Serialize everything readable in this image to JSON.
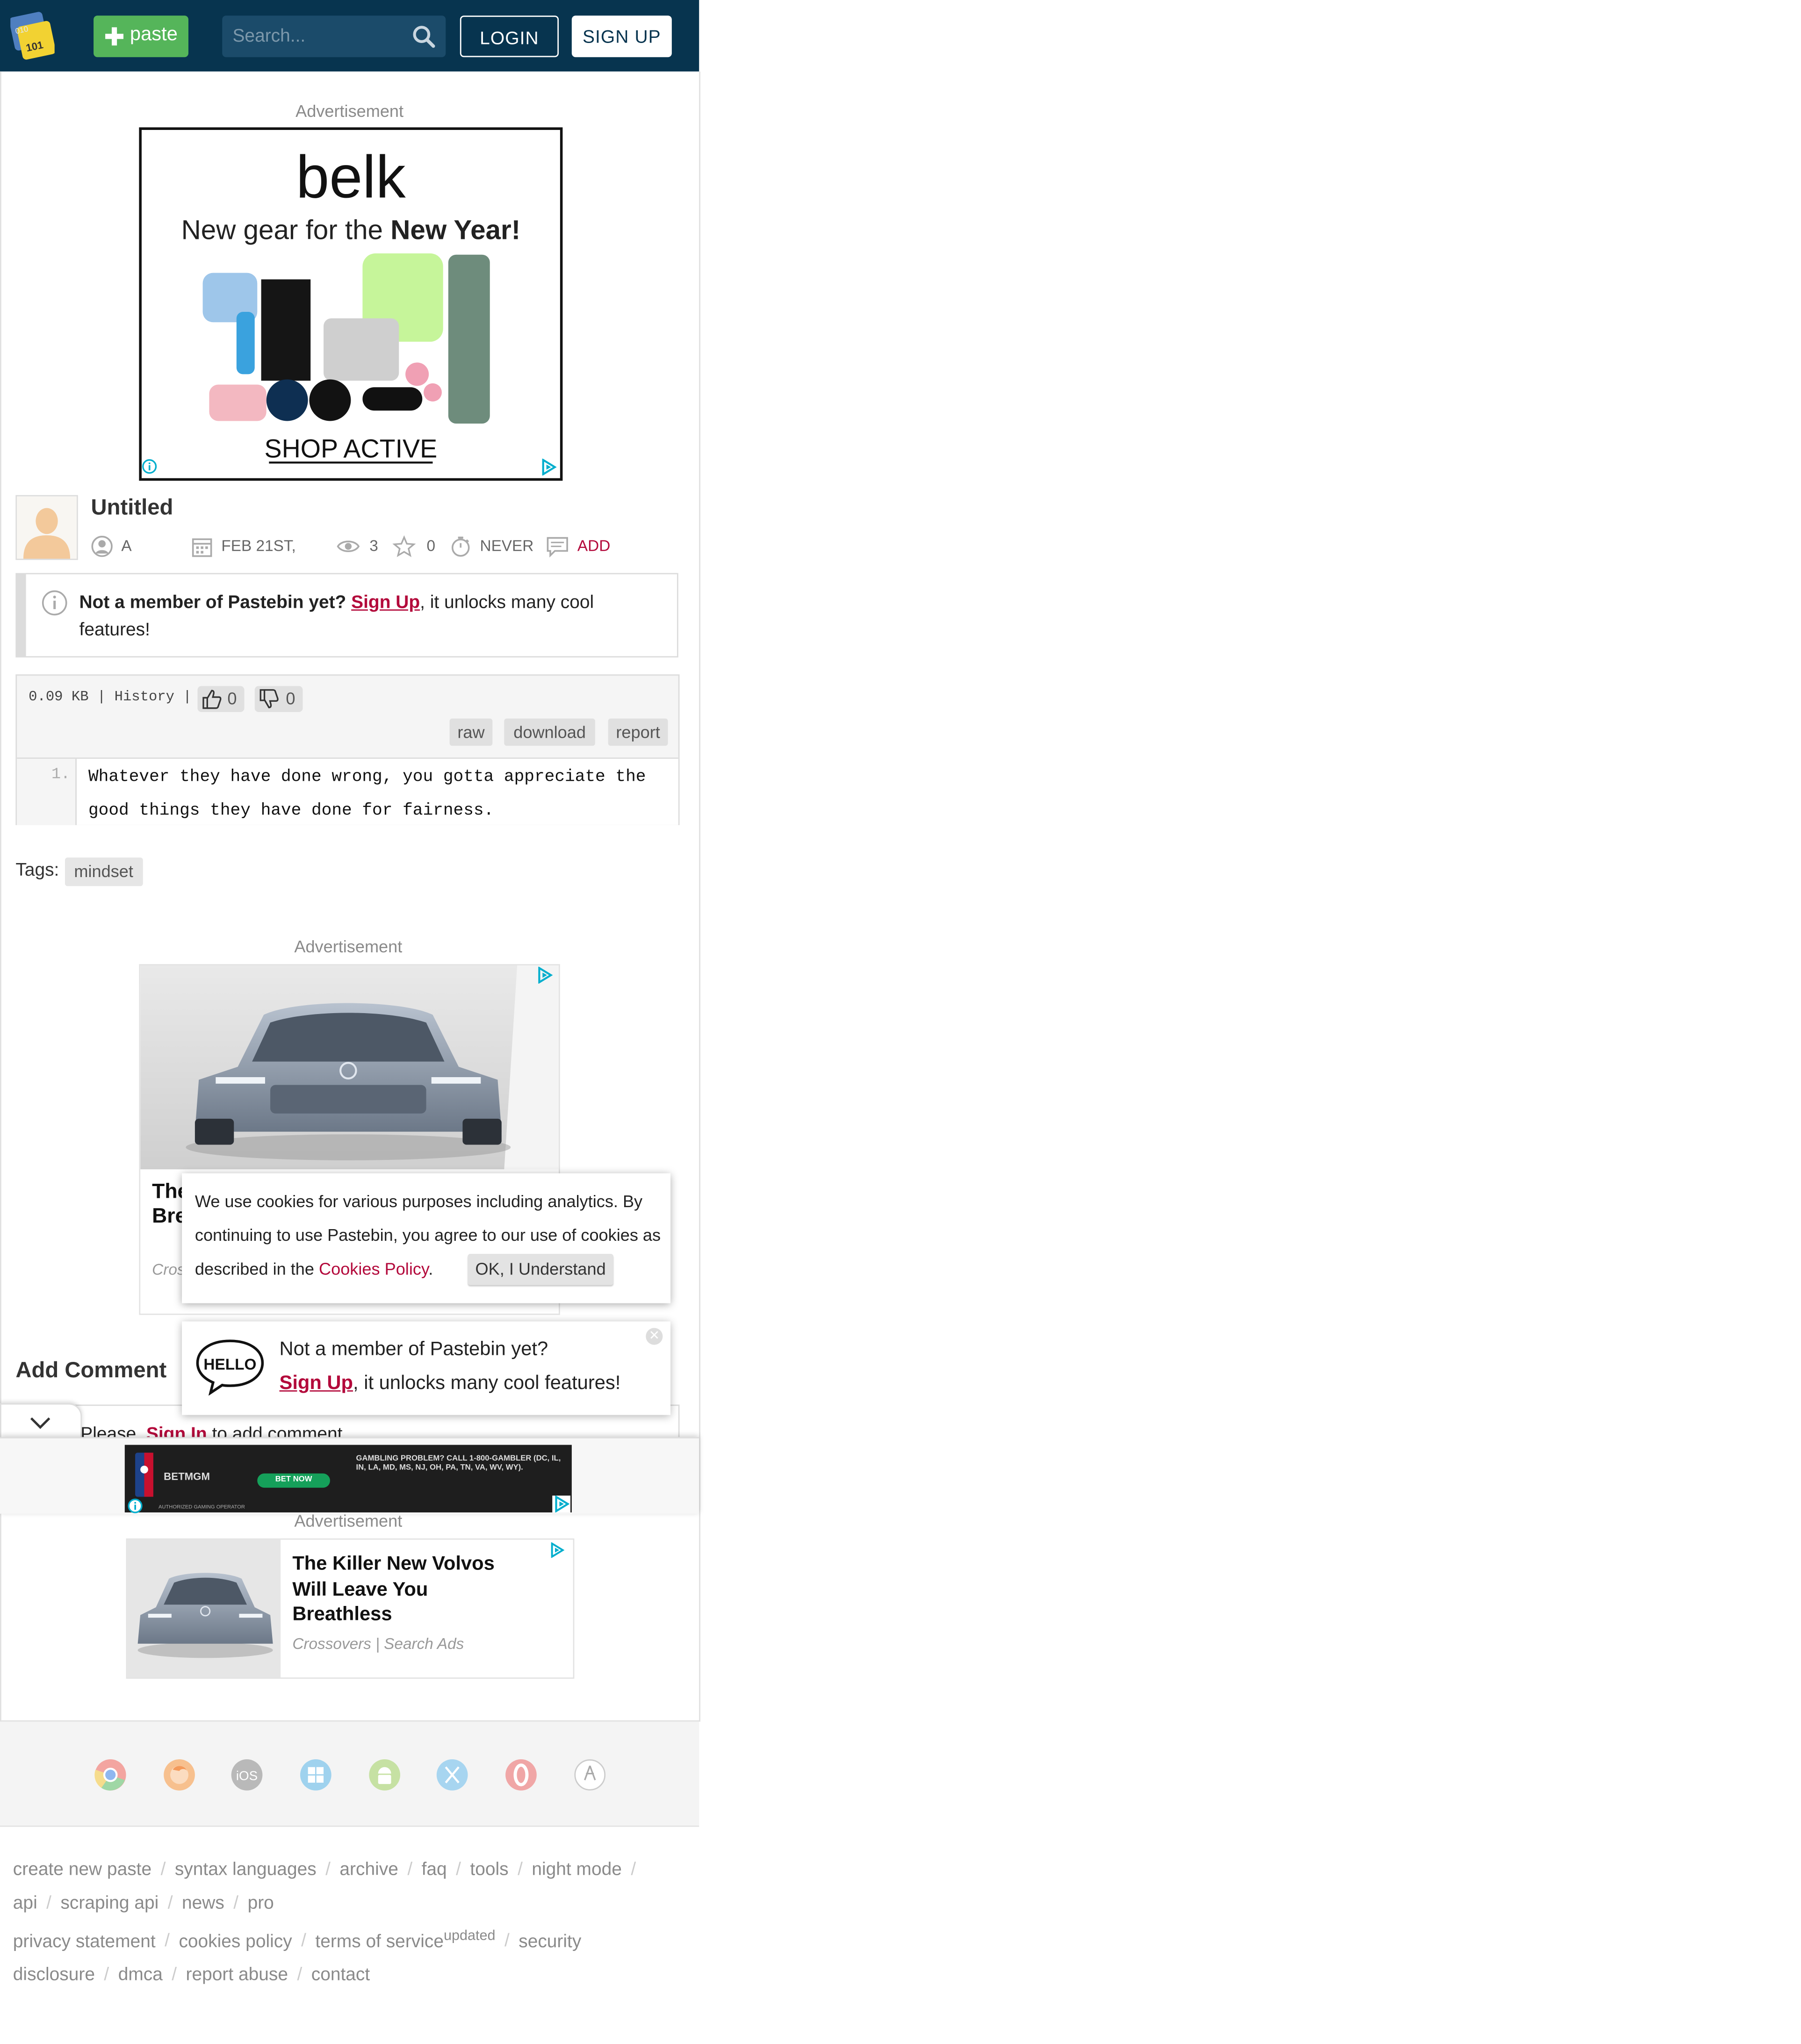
{
  "header": {
    "paste_label": "paste",
    "search_placeholder": "Search...",
    "login_label": "LOGIN",
    "signup_label": "SIGN UP"
  },
  "ads": {
    "label": "Advertisement",
    "belk": {
      "brand": "belk",
      "headline_pre": "New gear for the ",
      "headline_bold": "New Year!",
      "cta": "SHOP ACTIVE"
    },
    "volvo_card_title_fragment_1": "The",
    "volvo_card_title_fragment_2": "Bre",
    "volvo_card_source_fragment": "Cros",
    "sticky": {
      "brand": "BETMGM",
      "cta": "BET NOW",
      "notice": "GAMBLING PROBLEM? CALL 1-800-GAMBLER (DC, IL, IN, LA, MD, MS, NJ, OH, PA, TN, VA, WV, WY).",
      "auth": "AUTHORIZED GAMING OPERATOR"
    },
    "volvo2": {
      "title": "The Killer New Volvos Will Leave You Breathless",
      "source": "Crossovers | Search Ads"
    }
  },
  "paste": {
    "title": "Untitled",
    "author": "A",
    "date": "FEB 21ST,",
    "views": "3",
    "stars": "0",
    "expiry": "NEVER",
    "comments": "ADD",
    "size_history": "0.09 KB | History |",
    "likes": "0",
    "dislikes": "0",
    "buttons": {
      "raw": "raw",
      "download": "download",
      "report": "report"
    },
    "line_number": "1.",
    "code": "Whatever they have done wrong, you gotta appreciate the good things they have done for fairness.",
    "tags_label": "Tags:",
    "tag": "mindset"
  },
  "notice": {
    "bold": "Not a member of Pastebin yet?",
    "link": "Sign Up",
    "rest": ", it unlocks many cool features!"
  },
  "comments": {
    "heading": "Add Comment",
    "please": "Please,",
    "signin": "Sign In",
    "rest": "to add comment"
  },
  "cookie": {
    "text": "We use cookies for various purposes including analytics. By continuing to use Pastebin, you agree to our use of cookies as described in the",
    "link": "Cookies Policy",
    "end": ".",
    "ok": "OK, I Understand"
  },
  "hello": {
    "badge": "HELLO",
    "line1": "Not a member of Pastebin yet?",
    "link": "Sign Up",
    "rest": ", it unlocks many cool features!"
  },
  "browsers": [
    "chrome-icon",
    "firefox-icon",
    "ios-icon",
    "windows-icon",
    "android-icon",
    "mac-icon",
    "opera-icon",
    "linux-icon"
  ],
  "browser_ios_text": "iOS",
  "footer": {
    "links": [
      "create new paste",
      "syntax languages",
      "archive",
      "faq",
      "tools",
      "night mode",
      "api",
      "scraping api",
      "news",
      "pro",
      "privacy statement",
      "cookies policy",
      "terms of service",
      "security disclosure",
      "dmca",
      "report abuse",
      "contact"
    ],
    "updated": "updated"
  }
}
